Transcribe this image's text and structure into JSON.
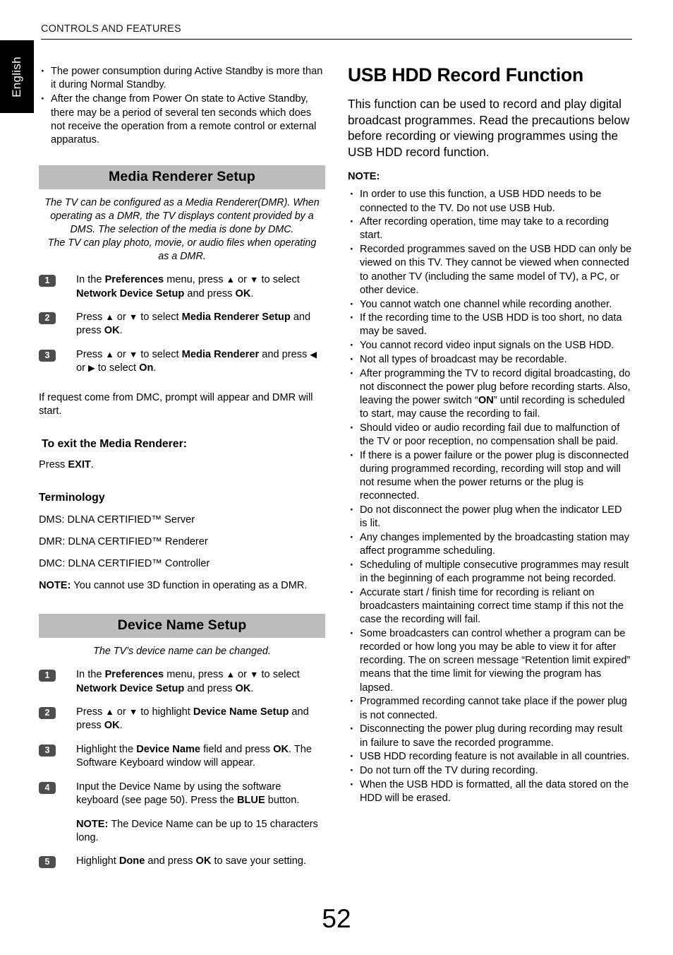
{
  "header": {
    "title": "CONTROLS AND FEATURES"
  },
  "language_tab": {
    "label": "English"
  },
  "page_number": "52",
  "left_column": {
    "standby_bullets": [
      "The power consumption during Active Standby is more than  it during Normal Standby.",
      "After the change from Power On state to Active Standby, there may be a period of several ten seconds which does not receive  the operation from a remote control or external apparatus."
    ],
    "media_renderer": {
      "banner": "Media Renderer Setup",
      "intro": "The TV can be configured as a Media Renderer(DMR). When operating as a DMR, the TV displays content provided by a DMS. The selection of the media is done by DMC.\nThe TV can play photo, movie, or audio files when operating as a DMR.",
      "intro_line_1": "The TV can be configured as a Media Renderer(DMR). When operating as a DMR, the TV displays content provided by a DMS. The selection of the media is done by DMC.",
      "intro_line_2": "The TV can play photo, movie, or audio files when operating as a DMR.",
      "steps": [
        {
          "number": "1",
          "parts": [
            {
              "text": "In the ",
              "bold": false
            },
            {
              "text": "Preferences",
              "bold": true
            },
            {
              "text": " menu, press ",
              "bold": false
            },
            {
              "text": "▲",
              "bold": false
            },
            {
              "text": " or ",
              "bold": false
            },
            {
              "text": "▼",
              "bold": false
            },
            {
              "text": " to select ",
              "bold": false
            },
            {
              "text": "Network Device Setup",
              "bold": true
            },
            {
              "text": " and press ",
              "bold": false
            },
            {
              "text": "OK",
              "bold": true
            },
            {
              "text": ".",
              "bold": false
            }
          ]
        },
        {
          "number": "2",
          "parts": [
            {
              "text": "Press ",
              "bold": false
            },
            {
              "text": "▲",
              "bold": false
            },
            {
              "text": " or ",
              "bold": false
            },
            {
              "text": "▼",
              "bold": false
            },
            {
              "text": " to select ",
              "bold": false
            },
            {
              "text": "Media Renderer Setup",
              "bold": true
            },
            {
              "text": " and press ",
              "bold": false
            },
            {
              "text": "OK",
              "bold": true
            },
            {
              "text": ".",
              "bold": false
            }
          ]
        },
        {
          "number": "3",
          "parts": [
            {
              "text": "Press ",
              "bold": false
            },
            {
              "text": "▲",
              "bold": false
            },
            {
              "text": " or ",
              "bold": false
            },
            {
              "text": "▼",
              "bold": false
            },
            {
              "text": " to select ",
              "bold": false
            },
            {
              "text": "Media Renderer",
              "bold": true
            },
            {
              "text": " and press ",
              "bold": false
            },
            {
              "text": "◀",
              "bold": false
            },
            {
              "text": " or ",
              "bold": false
            },
            {
              "text": "▶",
              "bold": false
            },
            {
              "text": " to select ",
              "bold": false
            },
            {
              "text": "On",
              "bold": true
            },
            {
              "text": ".",
              "bold": false
            }
          ]
        }
      ],
      "after_steps_text": "If request come from DMC, prompt will appear and DMR will start.",
      "exit_heading": "To exit the Media Renderer:",
      "exit_press_label": "Press ",
      "exit_press_key": "EXIT",
      "exit_press_period": ".",
      "terminology_heading": "Terminology",
      "terminology": [
        "DMS: DLNA CERTIFIED™ Server",
        "DMR: DLNA CERTIFIED™ Renderer",
        "DMC: DLNA CERTIFIED™ Controller"
      ],
      "note_label": "NOTE:",
      "note_text": " You cannot use 3D function in operating as a DMR."
    },
    "device_name": {
      "banner": "Device Name Setup",
      "intro": "The TV’s device name can be changed.",
      "steps": [
        {
          "number": "1",
          "parts": [
            {
              "text": "In the ",
              "bold": false
            },
            {
              "text": "Preferences",
              "bold": true
            },
            {
              "text": " menu, press ",
              "bold": false
            },
            {
              "text": "▲",
              "bold": false
            },
            {
              "text": " or ",
              "bold": false
            },
            {
              "text": "▼",
              "bold": false
            },
            {
              "text": " to select ",
              "bold": false
            },
            {
              "text": "Network Device Setup",
              "bold": true
            },
            {
              "text": " and press ",
              "bold": false
            },
            {
              "text": "OK",
              "bold": true
            },
            {
              "text": ".",
              "bold": false
            }
          ]
        },
        {
          "number": "2",
          "parts": [
            {
              "text": "Press ",
              "bold": false
            },
            {
              "text": "▲",
              "bold": false
            },
            {
              "text": " or ",
              "bold": false
            },
            {
              "text": "▼",
              "bold": false
            },
            {
              "text": " to highlight ",
              "bold": false
            },
            {
              "text": "Device Name Setup",
              "bold": true
            },
            {
              "text": " and press ",
              "bold": false
            },
            {
              "text": "OK",
              "bold": true
            },
            {
              "text": ".",
              "bold": false
            }
          ]
        },
        {
          "number": "3",
          "parts": [
            {
              "text": "Highlight the ",
              "bold": false
            },
            {
              "text": "Device Name",
              "bold": true
            },
            {
              "text": " field and press ",
              "bold": false
            },
            {
              "text": "OK",
              "bold": true
            },
            {
              "text": ". The Software Keyboard window will appear.",
              "bold": false
            }
          ]
        },
        {
          "number": "4",
          "parts": [
            {
              "text": "Input the Device Name by using the software keyboard (see page 50). Press the ",
              "bold": false
            },
            {
              "text": "BLUE",
              "bold": true
            },
            {
              "text": " button.",
              "bold": false
            }
          ],
          "sub_note_parts": [
            {
              "text": "NOTE:",
              "bold": true
            },
            {
              "text": " The Device Name can be up to 15 characters long.",
              "bold": false
            }
          ]
        },
        {
          "number": "5",
          "parts": [
            {
              "text": "Highlight ",
              "bold": false
            },
            {
              "text": "Done",
              "bold": true
            },
            {
              "text": " and press ",
              "bold": false
            },
            {
              "text": "OK",
              "bold": true
            },
            {
              "text": " to save your setting.",
              "bold": false
            }
          ]
        }
      ]
    }
  },
  "right_column": {
    "title": "USB HDD Record Function",
    "lead": "This function can be used to record and play digital broadcast programmes. Read the precautions below before recording or viewing programmes using the USB HDD record function.",
    "note_heading": "NOTE:",
    "notes": [
      "In order to use this function, a USB HDD needs to be connected to the TV. Do not use USB Hub.",
      "After recording operation, time may take to a recording start.",
      "Recorded programmes saved on the USB HDD can only be viewed on this TV. They cannot be viewed when connected to another TV (including the same model of TV), a PC, or other device.",
      "You cannot watch one channel while recording another.",
      "If the recording time to the USB HDD is too short, no data may be saved.",
      "You cannot record video input signals on the USB HDD.",
      "Not all types of broadcast may be recordable.",
      "After programming the TV to record digital broadcasting, do not disconnect the power plug before recording starts. Also, leaving the power switch “ON” until recording is scheduled to start, may cause the recording to fail.",
      "Should video or audio recording fail due to malfunction of the TV or poor reception, no compensation shall be paid.",
      "If there is a power failure or the power plug is disconnected during programmed recording, recording will stop and will not resume when the power returns or the plug is reconnected.",
      "Do not disconnect the power plug when the indicator LED is lit.",
      "Any changes implemented by the broadcasting station may affect programme scheduling.",
      "Scheduling of multiple consecutive programmes may result in the beginning of each programme not being recorded.",
      "Accurate start / finish time for recording is reliant on broadcasters maintaining correct time stamp if this not the case the recording will fail.",
      "Some broadcasters can control whether a program can be recorded or how long you may be able to view it for after recording. The on screen message “Retention limit expired” means that the time limit for viewing the program has lapsed.",
      "Programmed recording cannot take place if the power plug is not connected.",
      "Disconnecting the power plug during recording may result in failure to save the recorded programme.",
      "USB HDD recording feature is not available in all countries.",
      "Do not turn off the TV during recording.",
      "When the USB HDD is formatted, all the data stored on the HDD will be erased."
    ],
    "bold_fragments": {
      "power_switch_on": "ON"
    }
  },
  "colors": {
    "banner_grey": "#bcbcbc",
    "badge_grey": "#4d4d4d",
    "tab_black": "#000000",
    "text": "#000000"
  }
}
